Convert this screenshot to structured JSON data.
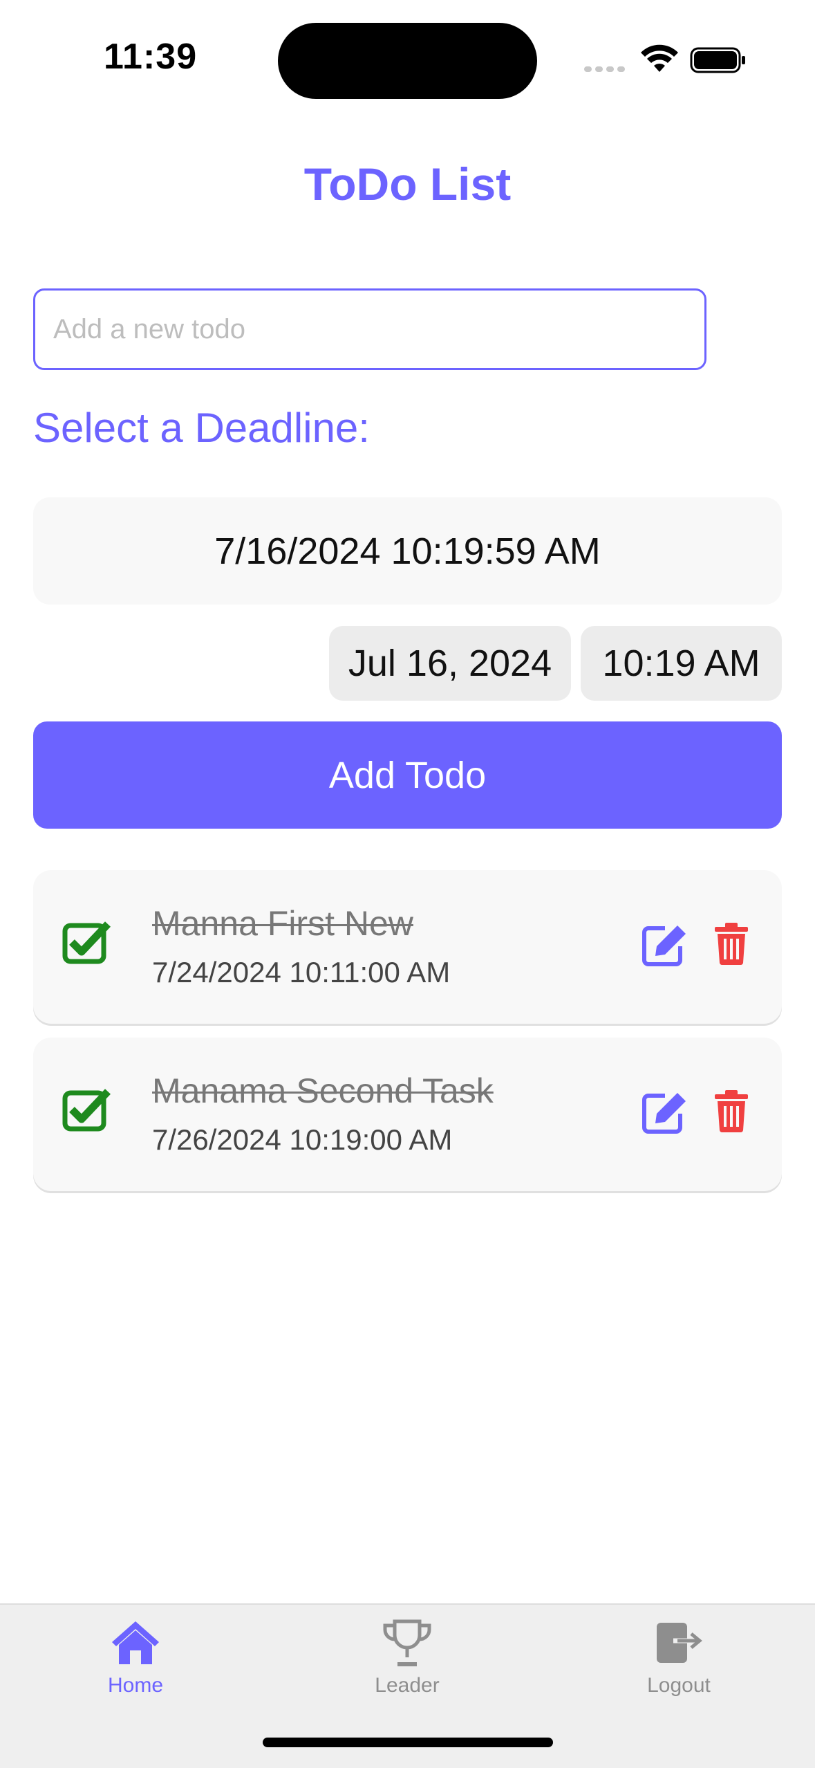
{
  "status_bar": {
    "time": "11:39"
  },
  "header": {
    "title": "ToDo List"
  },
  "form": {
    "input_placeholder": "Add a new todo",
    "input_value": "",
    "deadline_label": "Select a Deadline:",
    "deadline_display": "7/16/2024 10:19:59 AM",
    "date_picker_value": "Jul 16, 2024",
    "time_picker_value": "10:19 AM",
    "add_button_label": "Add Todo"
  },
  "todos": [
    {
      "title": "Manna First New",
      "deadline": "7/24/2024 10:11:00 AM",
      "completed": true
    },
    {
      "title": "Manama Second Task",
      "deadline": "7/26/2024 10:19:00 AM",
      "completed": true
    }
  ],
  "tab_bar": {
    "tabs": [
      {
        "label": "Home",
        "icon": "home-icon",
        "active": true
      },
      {
        "label": "Leader",
        "icon": "trophy-icon",
        "active": false
      },
      {
        "label": "Logout",
        "icon": "logout-icon",
        "active": false
      }
    ]
  },
  "colors": {
    "accent": "#6c63ff",
    "check": "#1e8a1e",
    "delete": "#f04040",
    "tab_inactive": "#8e8e8e"
  }
}
